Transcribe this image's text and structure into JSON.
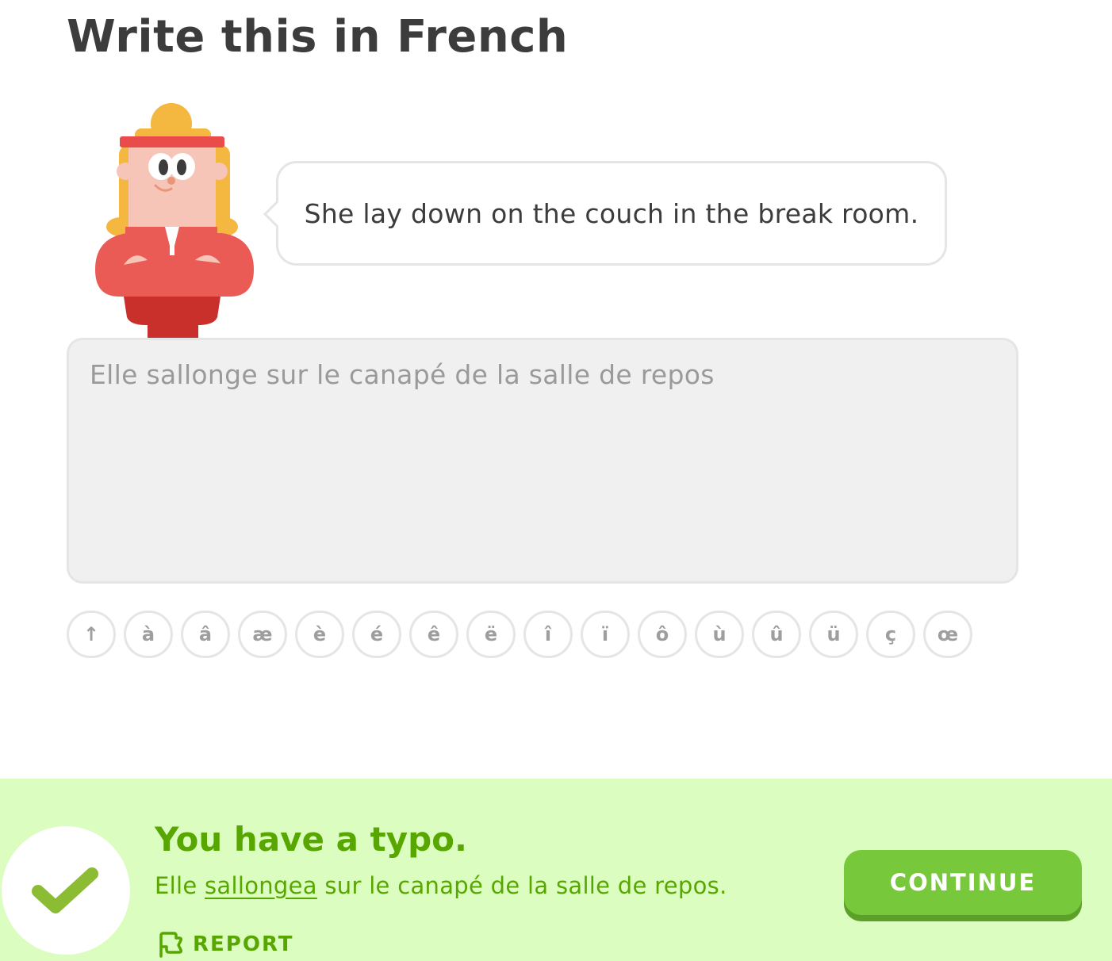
{
  "challenge": {
    "title": "Write this in French",
    "prompt_sentence": "She lay down on the couch in the break room.",
    "answer_text": "Elle sallonge sur le canapé de la salle de repos"
  },
  "special_keys": [
    "↑",
    "à",
    "â",
    "æ",
    "è",
    "é",
    "ê",
    "ë",
    "î",
    "ï",
    "ô",
    "ù",
    "û",
    "ü",
    "ç",
    "œ"
  ],
  "feedback": {
    "title": "You have a typo.",
    "correct_before": "Elle ",
    "correct_typo": "sallongea",
    "correct_after": " sur le canapé de la salle de repos.",
    "report_label": "REPORT",
    "continue_label": "CONTINUE",
    "colors": {
      "background": "#dbfdbf",
      "text": "#58a700",
      "button": "#78c83c"
    }
  },
  "icons": {
    "check": "check-icon",
    "report": "flag-icon",
    "character": "character-illustration"
  }
}
